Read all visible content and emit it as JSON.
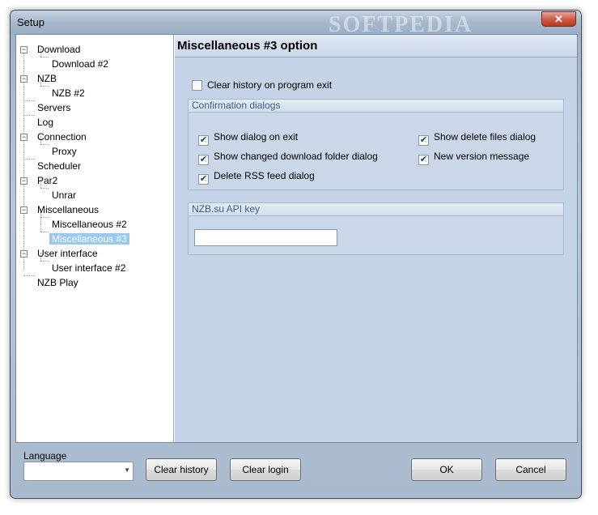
{
  "window": {
    "title": "Setup",
    "watermark": "SOFTPEDIA",
    "close_glyph": "✕"
  },
  "tree": {
    "items": [
      {
        "label": "Download",
        "expander": "−"
      },
      {
        "label": "Download #2"
      },
      {
        "label": "NZB",
        "expander": "−"
      },
      {
        "label": "NZB #2"
      },
      {
        "label": "Servers"
      },
      {
        "label": "Log"
      },
      {
        "label": "Connection",
        "expander": "−"
      },
      {
        "label": "Proxy"
      },
      {
        "label": "Scheduler"
      },
      {
        "label": "Par2",
        "expander": "−"
      },
      {
        "label": "Unrar"
      },
      {
        "label": "Miscellaneous",
        "expander": "−"
      },
      {
        "label": "Miscellaneous #2"
      },
      {
        "label": "Miscellaneous #3",
        "selected": true
      },
      {
        "label": "User interface",
        "expander": "−"
      },
      {
        "label": "User interface #2"
      },
      {
        "label": "NZB Play"
      }
    ]
  },
  "panel": {
    "title": "Miscellaneous #3 option",
    "clear_history_on_exit": {
      "label": "Clear history on program exit",
      "checked": false
    },
    "confirmation": {
      "title": "Confirmation dialogs",
      "options": [
        {
          "label": "Show dialog on exit",
          "checked": true
        },
        {
          "label": "Show changed download folder dialog",
          "checked": true
        },
        {
          "label": "Delete RSS feed dialog",
          "checked": true
        },
        {
          "label": "Show delete files dialog",
          "checked": true
        },
        {
          "label": "New version message",
          "checked": true
        }
      ],
      "check_glyph": "✔"
    },
    "api_key": {
      "title": "NZB.su API key",
      "value": ""
    }
  },
  "bottom": {
    "language_label": "Language",
    "language_value": "",
    "combo_arrow": "▼",
    "clear_history": "Clear history",
    "clear_login": "Clear login",
    "ok": "OK",
    "cancel": "Cancel"
  }
}
